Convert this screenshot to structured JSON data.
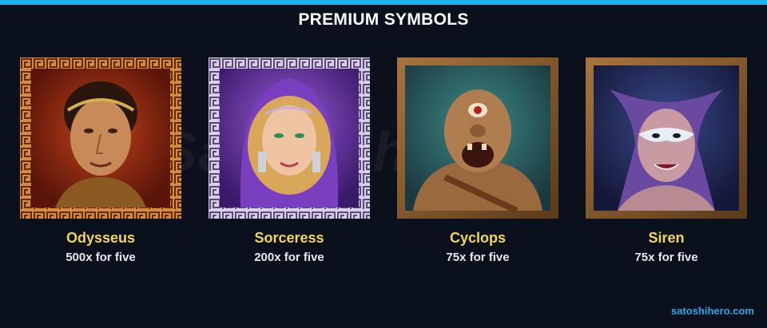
{
  "header": {
    "title": "PREMIUM SYMBOLS"
  },
  "symbols": [
    {
      "name": "Odysseus",
      "payout": "500x for five",
      "icon": "odysseus-portrait",
      "border_color": "#c8742a"
    },
    {
      "name": "Sorceress",
      "payout": "200x for five",
      "icon": "sorceress-portrait",
      "border_color": "#b9aecb"
    },
    {
      "name": "Cyclops",
      "payout": "75x for five",
      "icon": "cyclops-portrait",
      "border_color": "#8a5a2b"
    },
    {
      "name": "Siren",
      "payout": "75x for five",
      "icon": "siren-portrait",
      "border_color": "#8a5a2b"
    }
  ],
  "watermark": "Satoshihero",
  "footer": {
    "site": "satoshihero.com"
  },
  "colors": {
    "accent_bar": "#1bb3ea",
    "symbol_name": "#f2d65a",
    "background": "#0b111c"
  }
}
